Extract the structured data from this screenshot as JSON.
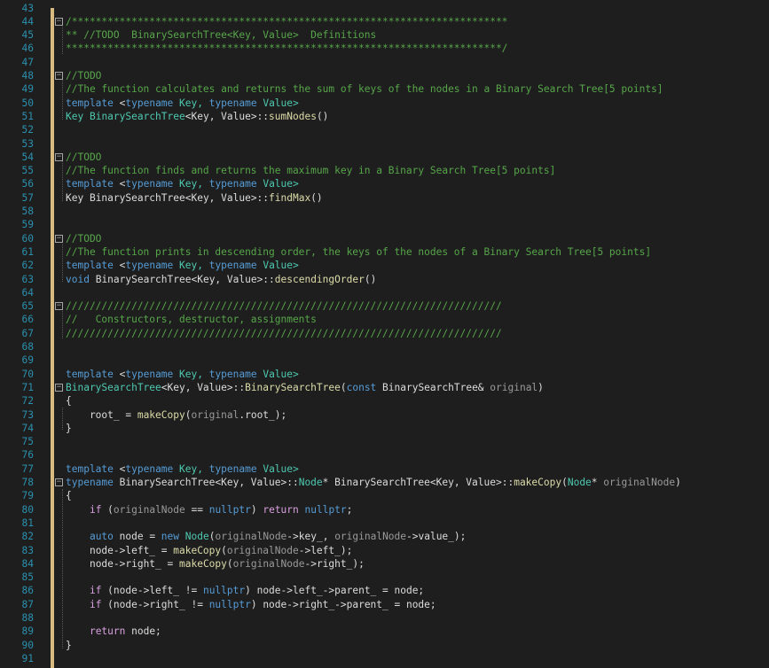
{
  "colors": {
    "background": "#1e1e1e",
    "line_number": "#2b91af",
    "keyword": "#569cd6",
    "type": "#4ec9b0",
    "comment": "#57a64a",
    "function": "#dcdcaa",
    "change_bar": "#d7ba7d"
  },
  "line_numbers": [
    "43",
    "44",
    "45",
    "46",
    "47",
    "48",
    "49",
    "50",
    "51",
    "52",
    "53",
    "54",
    "55",
    "56",
    "57",
    "58",
    "59",
    "60",
    "61",
    "62",
    "63",
    "64",
    "65",
    "66",
    "67",
    "68",
    "69",
    "70",
    "71",
    "72",
    "73",
    "74",
    "75",
    "76",
    "77",
    "78",
    "79",
    "80",
    "81",
    "82",
    "83",
    "84",
    "85",
    "86",
    "87",
    "88",
    "89",
    "90",
    "91"
  ],
  "code": {
    "l44": "/*************************************************************************",
    "l45": "** //TODO  BinarySearchTree<Key, Value>  Definitions",
    "l46": "*************************************************************************/",
    "l48": "//TODO",
    "l49": "//The function calculates and returns the sum of keys of the nodes in a Binary Search Tree[5 points]",
    "template_kw": "template",
    "lt": "<",
    "typename_kw": "typename",
    "key_tparam": " Key, ",
    "value_close": " Value>",
    "l51_key": "Key",
    "bst": "BinarySearchTree",
    "kv": "<Key, Value>::",
    "l51_fn": "sumNodes",
    "parens": "()",
    "l54": "//TODO",
    "l55": "//The function finds and returns the maximum key in a Binary Search Tree[5 points]",
    "l57_pre": "Key ",
    "l57_fn": "findMax",
    "l60": "//TODO",
    "l61": "//The function prints in descending order, the keys of the nodes of a Binary Search Tree[5 points]",
    "void_kw": "void",
    "l63_fn": "descendingOrder",
    "l65": "/////////////////////////////////////////////////////////////////////////",
    "l66": "//   Constructors, destructor, assignments",
    "l67": "/////////////////////////////////////////////////////////////////////////",
    "l71_fn": "BinarySearchTree",
    "l71_open": "(",
    "const_kw": "const",
    "l71_type": " BinarySearchTree& ",
    "l71_param": "original",
    "l71_close": ")",
    "brace_open": "{",
    "brace_close": "}",
    "l73_pre": "    root_ = ",
    "make_copy": "makeCopy",
    "l73_arg_open": "(",
    "l73_arg": "original",
    "l73_arg_rest": ".root_);",
    "typename_word": "typename",
    "l78_mid": " BinarySearchTree<Key, Value>::",
    "node_type": "Node",
    "l78_mid2": "* BinarySearchTree<Key, Value>::",
    "l78_open": "(",
    "l78_ptype": "Node",
    "l78_star": "* ",
    "l78_param": "originalNode",
    "l78_close": ")",
    "indent": "    ",
    "if_kw": "if",
    "return_kw": "return",
    "nullptr_kw": "nullptr",
    "l80_a": " (",
    "l80_var": "originalNode",
    "l80_b": " == ",
    "l80_c": ") ",
    "l80_d": " ",
    "semicolon": ";",
    "auto_kw": "auto",
    "l82_a": " node = ",
    "new_kw": "new",
    "l82_b": " ",
    "l82_c": "(",
    "l82_var1": "originalNode",
    "l82_d": "->key_, ",
    "l82_var2": "originalNode",
    "l82_e": "->value_);",
    "l83_a": "node->left_ = ",
    "l83_b": "(",
    "l83_var": "originalNode",
    "l83_c": "->left_);",
    "l84_a": "node->right_ = ",
    "l84_b": "(",
    "l84_var": "originalNode",
    "l84_c": "->right_);",
    "l86_a": " (node->left_ != ",
    "l86_b": ") node->left_->parent_ = node;",
    "l87_a": " (node->right_ != ",
    "l87_b": ") node->right_->parent_ = node;",
    "l89_a": " node;"
  }
}
